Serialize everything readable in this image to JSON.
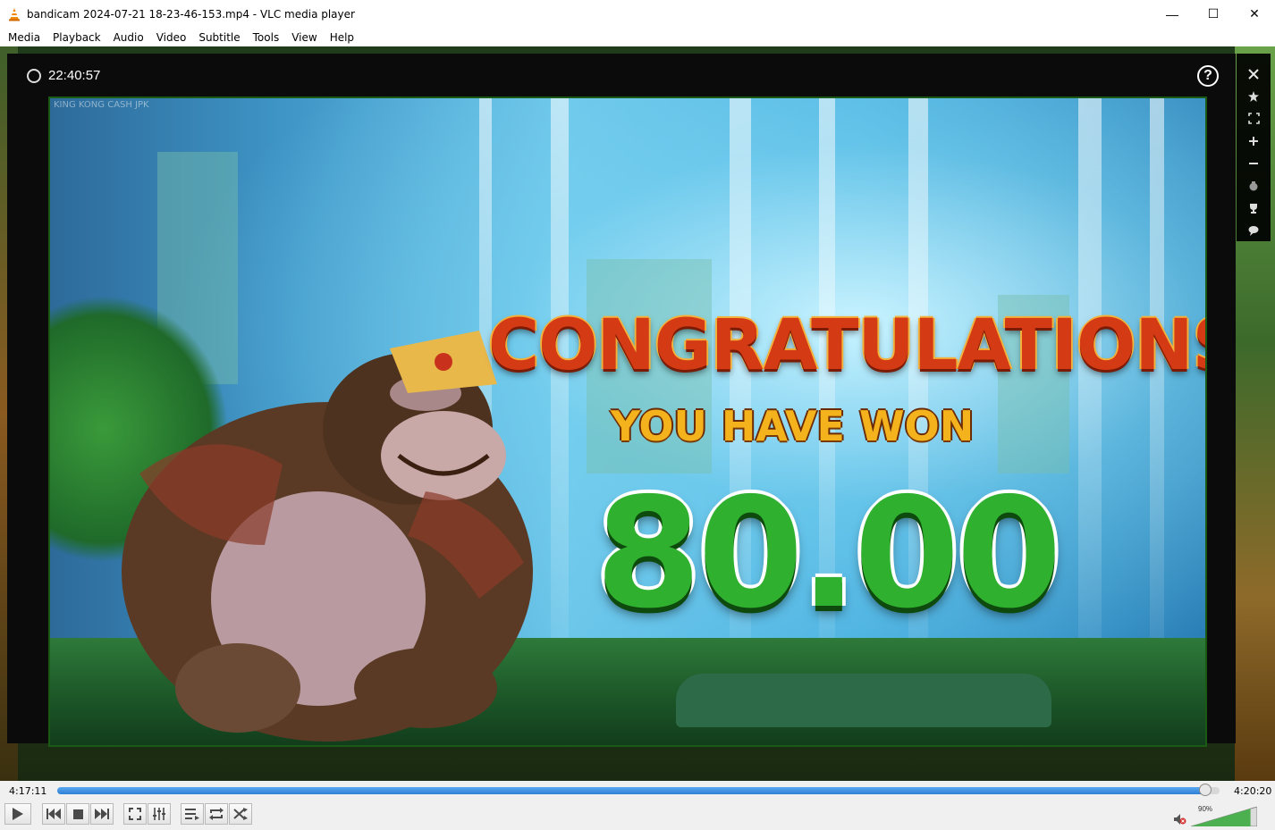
{
  "window": {
    "title": "bandicam 2024-07-21 18-23-46-153.mp4 - VLC media player",
    "app_icon": "vlc-cone-icon",
    "buttons": {
      "minimize": "—",
      "maximize": "☐",
      "close": "✕"
    }
  },
  "menu": {
    "items": [
      {
        "label": "Media"
      },
      {
        "label": "Playback"
      },
      {
        "label": "Audio"
      },
      {
        "label": "Video"
      },
      {
        "label": "Subtitle"
      },
      {
        "label": "Tools"
      },
      {
        "label": "View"
      },
      {
        "label": "Help"
      }
    ]
  },
  "osd": {
    "clock": "22:40:57",
    "help_label": "?",
    "side_icons": [
      "close-icon",
      "star-icon",
      "fullscreen-icon",
      "zoom-in-icon",
      "zoom-out-icon",
      "snapshot-icon",
      "trophy-icon",
      "chat-icon"
    ]
  },
  "video": {
    "game_tag": "KING KONG CASH JPK",
    "headline": "CONGRATULATIONS",
    "subline": "YOU HAVE WON",
    "amount": "80.00"
  },
  "player": {
    "elapsed": "4:17:11",
    "total": "4:20:20",
    "progress_fraction": 0.988,
    "volume_label": "90%",
    "volume_fraction": 0.9
  },
  "colors": {
    "accent": "#2f7fd6",
    "headline": "#d43a14",
    "amount": "#2fb12f"
  }
}
